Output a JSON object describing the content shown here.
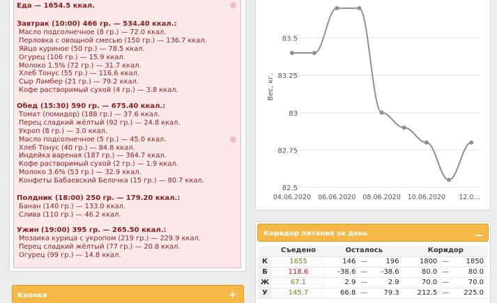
{
  "food_log": {
    "total": "Еда — 1654.5 ккал.",
    "meals": [
      {
        "head": "Завтрак (10:00) 466 гр. — 534.40 ккал.:",
        "items": [
          "Масло подсолнечное (8 гр.) — 72.0 ккал.",
          "Перловка с овощной смесью (150 гр.) — 136.7 ккал.",
          "Яйцо куриное (50 гр.) — 78.5 ккал.",
          "Огурец (106 гр.) — 15.9 ккал.",
          "Молоко 1.5% (72 гр.) — 31.7 ккал.",
          "Хлеб Тонус (55 гр.) — 116.6 ккал.",
          "Сыр Ламбер (21 гр.) — 79.2 ккал.",
          "Кофе растворимый сухой (4 гр.) — 3.8 ккал."
        ]
      },
      {
        "head": "Обед (15:30) 590 гр. — 675.40 ккал.:",
        "items": [
          "Томат (помидор) (188 гр.) — 37.6 ккал.",
          "Перец сладкий жёлтый (92 гр.) — 24.8 ккал.",
          "Укроп (8 гр.) — 3.0 ккал.",
          "Масло подсолнечное (5 гр.) — 45.0 ккал.",
          "Хлеб Тонус (40 гр.) — 84.8 ккал.",
          "Индейка вареная (187 гр.) — 364.7 ккал.",
          "Кофе растворимый сухой (2 гр.) — 1.9 ккал.",
          "Молоко 3.6% (53 гр.) — 32.9 ккал.",
          "Конфеты Бабаевский Белочка (15 гр.) — 80.7 ккал."
        ]
      },
      {
        "head": "Полдник (18:00) 250 гр. — 179.20 ккал.:",
        "items": [
          "Банан (140 гр.) — 133.0 ккал.",
          "Слива (110 гр.) — 46.2 ккал."
        ]
      },
      {
        "head": "Ужин (19:00) 395 гр. — 265.50 ккал.:",
        "items": [
          "Мозаика курица с укропом (219 гр.) — 229.9 ккал.",
          "Перец сладкий жёлтый (77 гр.) — 20.8 ккал.",
          "Огурец (99 гр.) — 14.8 ккал."
        ]
      }
    ]
  },
  "buttons_panel": {
    "title": "Кнопки",
    "toggle": "+"
  },
  "chart_data": {
    "type": "line",
    "ylabel": "Вес, кг.",
    "ylim": [
      82.5,
      83.75
    ],
    "yticks": [
      82.5,
      82.75,
      83,
      83.25,
      83.5
    ],
    "ytick_labels": [
      "82.5",
      "82.75",
      "83",
      "83.25",
      "83.5"
    ],
    "x_tick_labels": [
      "04.06.2020",
      "06.06.2020",
      "08.06.2020",
      "10.06.2020",
      "12.0…"
    ],
    "x_ticks": [
      0,
      2,
      4,
      6,
      8
    ],
    "xlim": [
      0,
      8.4
    ],
    "x": [
      0,
      1,
      2,
      3,
      4,
      5,
      6,
      7,
      8
    ],
    "values": [
      83.4,
      83.4,
      83.7,
      83.7,
      83.0,
      82.9,
      82.8,
      82.55,
      82.8
    ],
    "color": "#8e8e8e"
  },
  "corridor": {
    "title": "Коридор питания за день",
    "headers": {
      "eaten": "Съедено",
      "left": "Осталось",
      "corridor": "Коридор"
    },
    "rows": [
      {
        "label": "К",
        "eaten": "1655",
        "left_min": "146",
        "left_max": "196",
        "cor_min": "1800",
        "cor_max": "1850"
      },
      {
        "label": "Б",
        "eaten": "118.6",
        "left_min": "-38.6",
        "left_max": "-38.6",
        "cor_min": "80.0",
        "cor_max": "80.0"
      },
      {
        "label": "Ж",
        "eaten": "67.1",
        "left_min": "2.9",
        "left_max": "2.9",
        "cor_min": "70.0",
        "cor_max": "70.0"
      },
      {
        "label": "У",
        "eaten": "145.7",
        "left_min": "66.8",
        "left_max": "79.3",
        "cor_min": "212.5",
        "cor_max": "225.0"
      }
    ],
    "dash": "—"
  }
}
